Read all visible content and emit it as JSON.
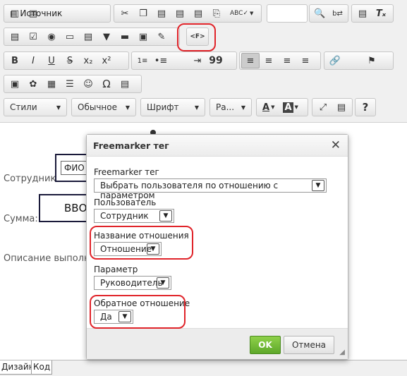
{
  "toolbar": {
    "source_label": "Источник",
    "styles_label": "Стили",
    "format_label": "Обычное",
    "font_label": "Шрифт",
    "size_label": "Ра...",
    "omega_label": "Ω",
    "quote_label": "99",
    "bold_label": "B",
    "italic_label": "I",
    "underline_label": "U",
    "strike_label": "S",
    "sub_label": "x₂",
    "sup_label": "x²",
    "help_label": "?",
    "fm_label": "<F>"
  },
  "editor": {
    "employee_label": "Сотрудник:",
    "fio_field": "ФИО",
    "sum_label": "Сумма:",
    "input_field": "ВВО",
    "description_label": "Описание выполне"
  },
  "dialog": {
    "title": "Freemarker тег",
    "close_label": "✕",
    "tag_label": "Freemarker тег",
    "tag_value": "Выбрать пользователя по отношению с параметром",
    "user_label": "Пользователь",
    "user_value": "Сотрудник",
    "relation_label": "Название отношения",
    "relation_value": "Отношение",
    "param_label": "Параметр",
    "param_value": "Руководитель",
    "reverse_label": "Обратное отношение",
    "reverse_value": "Да",
    "ok_label": "OK",
    "cancel_label": "Отмена"
  },
  "tabs": {
    "design_label": "Дизайн",
    "code_label": "Код"
  },
  "colors": {
    "highlight": "#e0242a",
    "ok_button": "#6bb532"
  }
}
